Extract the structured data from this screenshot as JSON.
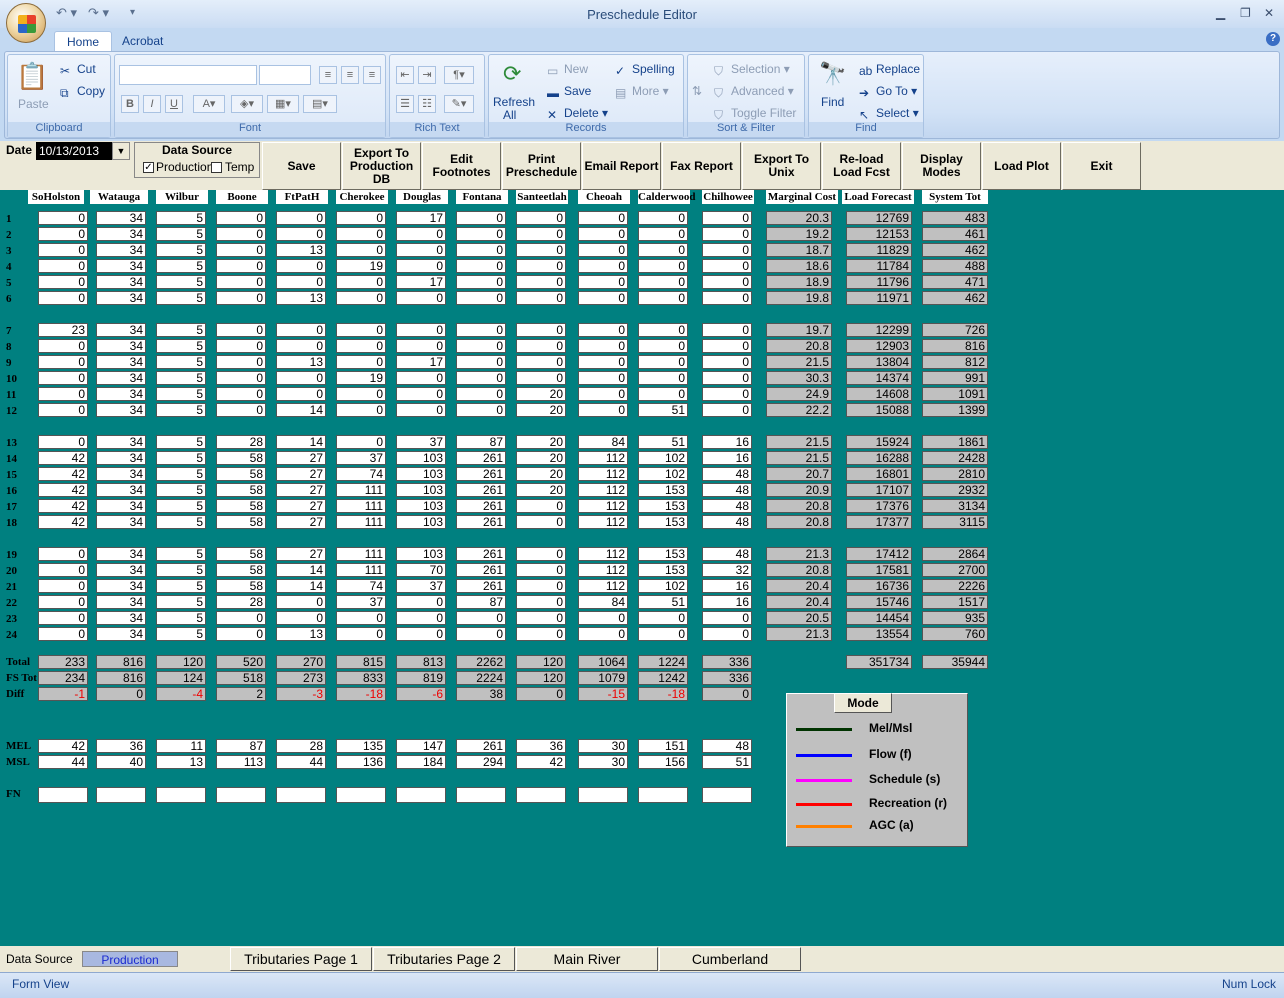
{
  "window": {
    "title": "Preschedule Editor",
    "tabs": [
      {
        "label": "Home",
        "active": true
      },
      {
        "label": "Acrobat",
        "active": false
      }
    ]
  },
  "ribbon": {
    "clipboard": {
      "label": "Clipboard",
      "paste": "Paste",
      "cut": "Cut",
      "copy": "Copy"
    },
    "font": {
      "label": "Font"
    },
    "rich_text": {
      "label": "Rich Text"
    },
    "records": {
      "label": "Records",
      "refresh": "Refresh",
      "refresh_sub": "All",
      "new": "New",
      "save": "Save",
      "delete": "Delete",
      "spelling": "Spelling",
      "more": "More"
    },
    "sort_filter": {
      "label": "Sort & Filter",
      "selection": "Selection",
      "advanced": "Advanced",
      "toggle": "Toggle Filter"
    },
    "find": {
      "label": "Find",
      "find": "Find",
      "replace": "Replace",
      "goto": "Go To",
      "select": "Select"
    }
  },
  "form": {
    "date_label": "Date",
    "date_value": "10/13/2013",
    "data_source": {
      "title": "Data Source",
      "production": "Production",
      "temp": "Temp",
      "production_checked": true,
      "temp_checked": false
    },
    "commands": [
      "Save",
      "Export To\nProduction\nDB",
      "Edit\nFootnotes",
      "Print\nPreschedule",
      "Email Report",
      "Fax Report",
      "Export To\nUnix",
      "Re-load\nLoad Fcst",
      "Display\nModes",
      "Load Plot",
      "Exit"
    ],
    "columns": [
      "SoHolston",
      "Watauga",
      "Wilbur",
      "Boone",
      "FtPatH",
      "Cherokee",
      "Douglas",
      "Fontana",
      "Santeetlah",
      "Cheoah",
      "Calderwood",
      "Chilhowee",
      "Marginal Cost",
      "Load Forecast",
      "System Tot"
    ],
    "hours": [
      {
        "h": "1",
        "v": [
          0,
          34,
          5,
          0,
          0,
          0,
          17,
          0,
          0,
          0,
          0,
          0
        ],
        "mc": "20.3",
        "lf": "12769",
        "st": "483"
      },
      {
        "h": "2",
        "v": [
          0,
          34,
          5,
          0,
          0,
          0,
          0,
          0,
          0,
          0,
          0,
          0
        ],
        "mc": "19.2",
        "lf": "12153",
        "st": "461"
      },
      {
        "h": "3",
        "v": [
          0,
          34,
          5,
          0,
          13,
          0,
          0,
          0,
          0,
          0,
          0,
          0
        ],
        "mc": "18.7",
        "lf": "11829",
        "st": "462"
      },
      {
        "h": "4",
        "v": [
          0,
          34,
          5,
          0,
          0,
          19,
          0,
          0,
          0,
          0,
          0,
          0
        ],
        "mc": "18.6",
        "lf": "11784",
        "st": "488"
      },
      {
        "h": "5",
        "v": [
          0,
          34,
          5,
          0,
          0,
          0,
          17,
          0,
          0,
          0,
          0,
          0
        ],
        "mc": "18.9",
        "lf": "11796",
        "st": "471"
      },
      {
        "h": "6",
        "v": [
          0,
          34,
          5,
          0,
          13,
          0,
          0,
          0,
          0,
          0,
          0,
          0
        ],
        "mc": "19.8",
        "lf": "11971",
        "st": "462"
      },
      {
        "h": "7",
        "v": [
          23,
          34,
          5,
          0,
          0,
          0,
          0,
          0,
          0,
          0,
          0,
          0
        ],
        "mc": "19.7",
        "lf": "12299",
        "st": "726"
      },
      {
        "h": "8",
        "v": [
          0,
          34,
          5,
          0,
          0,
          0,
          0,
          0,
          0,
          0,
          0,
          0
        ],
        "mc": "20.8",
        "lf": "12903",
        "st": "816"
      },
      {
        "h": "9",
        "v": [
          0,
          34,
          5,
          0,
          13,
          0,
          17,
          0,
          0,
          0,
          0,
          0
        ],
        "mc": "21.5",
        "lf": "13804",
        "st": "812"
      },
      {
        "h": "10",
        "v": [
          0,
          34,
          5,
          0,
          0,
          19,
          0,
          0,
          0,
          0,
          0,
          0
        ],
        "mc": "30.3",
        "lf": "14374",
        "st": "991"
      },
      {
        "h": "11",
        "v": [
          0,
          34,
          5,
          0,
          0,
          0,
          0,
          0,
          20,
          0,
          0,
          0
        ],
        "mc": "24.9",
        "lf": "14608",
        "st": "1091"
      },
      {
        "h": "12",
        "v": [
          0,
          34,
          5,
          0,
          14,
          0,
          0,
          0,
          20,
          0,
          51,
          0
        ],
        "mc": "22.2",
        "lf": "15088",
        "st": "1399"
      },
      {
        "h": "13",
        "v": [
          0,
          34,
          5,
          28,
          14,
          0,
          37,
          87,
          20,
          84,
          51,
          16
        ],
        "mc": "21.5",
        "lf": "15924",
        "st": "1861"
      },
      {
        "h": "14",
        "v": [
          42,
          34,
          5,
          58,
          27,
          37,
          103,
          261,
          20,
          112,
          102,
          16
        ],
        "mc": "21.5",
        "lf": "16288",
        "st": "2428"
      },
      {
        "h": "15",
        "v": [
          42,
          34,
          5,
          58,
          27,
          74,
          103,
          261,
          20,
          112,
          102,
          48
        ],
        "mc": "20.7",
        "lf": "16801",
        "st": "2810"
      },
      {
        "h": "16",
        "v": [
          42,
          34,
          5,
          58,
          27,
          111,
          103,
          261,
          20,
          112,
          153,
          48
        ],
        "mc": "20.9",
        "lf": "17107",
        "st": "2932"
      },
      {
        "h": "17",
        "v": [
          42,
          34,
          5,
          58,
          27,
          111,
          103,
          261,
          0,
          112,
          153,
          48
        ],
        "mc": "20.8",
        "lf": "17376",
        "st": "3134"
      },
      {
        "h": "18",
        "v": [
          42,
          34,
          5,
          58,
          27,
          111,
          103,
          261,
          0,
          112,
          153,
          48
        ],
        "mc": "20.8",
        "lf": "17377",
        "st": "3115"
      },
      {
        "h": "19",
        "v": [
          0,
          34,
          5,
          58,
          27,
          111,
          103,
          261,
          0,
          112,
          153,
          48
        ],
        "mc": "21.3",
        "lf": "17412",
        "st": "2864"
      },
      {
        "h": "20",
        "v": [
          0,
          34,
          5,
          58,
          14,
          111,
          70,
          261,
          0,
          112,
          153,
          32
        ],
        "mc": "20.8",
        "lf": "17581",
        "st": "2700"
      },
      {
        "h": "21",
        "v": [
          0,
          34,
          5,
          58,
          14,
          74,
          37,
          261,
          0,
          112,
          102,
          16
        ],
        "mc": "20.4",
        "lf": "16736",
        "st": "2226"
      },
      {
        "h": "22",
        "v": [
          0,
          34,
          5,
          28,
          0,
          37,
          0,
          87,
          0,
          84,
          51,
          16
        ],
        "mc": "20.4",
        "lf": "15746",
        "st": "1517"
      },
      {
        "h": "23",
        "v": [
          0,
          34,
          5,
          0,
          0,
          0,
          0,
          0,
          0,
          0,
          0,
          0
        ],
        "mc": "20.5",
        "lf": "14454",
        "st": "935"
      },
      {
        "h": "24",
        "v": [
          0,
          34,
          5,
          0,
          13,
          0,
          0,
          0,
          0,
          0,
          0,
          0
        ],
        "mc": "21.3",
        "lf": "13554",
        "st": "760"
      }
    ],
    "total": {
      "label": "Total",
      "v": [
        233,
        816,
        120,
        520,
        270,
        815,
        813,
        2262,
        120,
        1064,
        1224,
        336
      ],
      "lf": "351734",
      "st": "35944"
    },
    "fs_tot": {
      "label": "FS Tot",
      "v": [
        234,
        816,
        124,
        518,
        273,
        833,
        819,
        2224,
        120,
        1079,
        1242,
        336
      ]
    },
    "diff": {
      "label": "Diff",
      "v": [
        -1,
        0,
        -4,
        2,
        -3,
        -18,
        -6,
        38,
        0,
        -15,
        -18,
        0
      ]
    },
    "mel": {
      "label": "MEL",
      "v": [
        42,
        36,
        11,
        87,
        28,
        135,
        147,
        261,
        36,
        30,
        151,
        48
      ]
    },
    "msl": {
      "label": "MSL",
      "v": [
        44,
        40,
        13,
        113,
        44,
        136,
        184,
        294,
        42,
        30,
        156,
        51
      ]
    },
    "fn": {
      "label": "FN"
    },
    "modes": {
      "title": "Mode",
      "items": [
        {
          "label": "Mel/Msl",
          "color": "#003300"
        },
        {
          "label": "Flow (f)",
          "color": "#0000ff"
        },
        {
          "label": "Schedule (s)",
          "color": "#ff00ff"
        },
        {
          "label": "Recreation (r)",
          "color": "#ff0000"
        },
        {
          "label": "AGC (a)",
          "color": "#ff8000"
        }
      ]
    }
  },
  "bottom": {
    "data_source_label": "Data Source",
    "data_source_value": "Production",
    "pages": [
      "Tributaries Page 1",
      "Tributaries Page 2",
      "Main River",
      "Cumberland"
    ]
  },
  "status": {
    "left": "Form View",
    "right": "Num Lock"
  }
}
